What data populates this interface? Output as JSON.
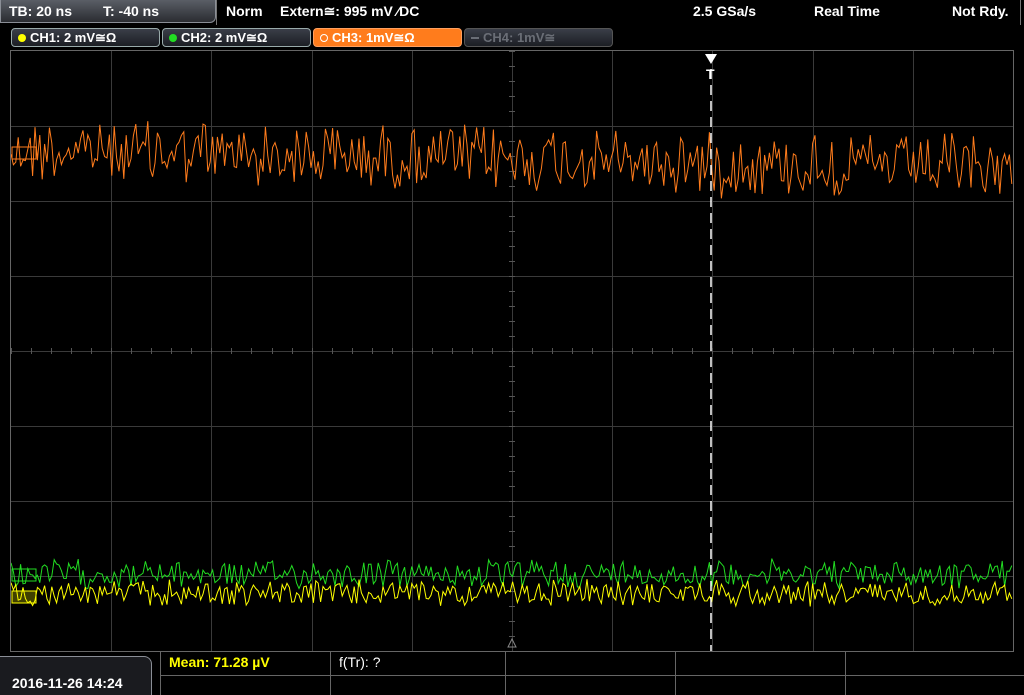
{
  "status": {
    "timebase": "TB: 20 ns",
    "trigger_time": "T: -40 ns",
    "mode": "Norm",
    "trigger_source": "Extern≅: 995 mV ⁄DC",
    "sample_rate": "2.5 GSa/s",
    "acq_mode": "Real Time",
    "state": "Not Rdy."
  },
  "channels": [
    {
      "label": "CH1: 2 mV≅Ω",
      "color": "#ffff00",
      "active": false,
      "enabled": true
    },
    {
      "label": "CH2: 2 mV≅Ω",
      "color": "#22dd22",
      "active": false,
      "enabled": true
    },
    {
      "label": "CH3: 1mV≅Ω",
      "color": "#ff7c1c",
      "active": true,
      "enabled": true
    },
    {
      "label": "CH4: 1mV≅",
      "color": "#6a6e76",
      "active": false,
      "enabled": false
    }
  ],
  "trigger_marker": "T",
  "datetime": "2016-11-26 14:24",
  "measurements": {
    "mean": "Mean: 71.28 µV",
    "ftr": "f(Tr): ?"
  },
  "colors": {
    "ch1": "#ffff00",
    "ch2": "#22dd22",
    "ch3": "#ff7c1c",
    "grid": "#3a3a3a",
    "accent": "#ff7c1c"
  }
}
